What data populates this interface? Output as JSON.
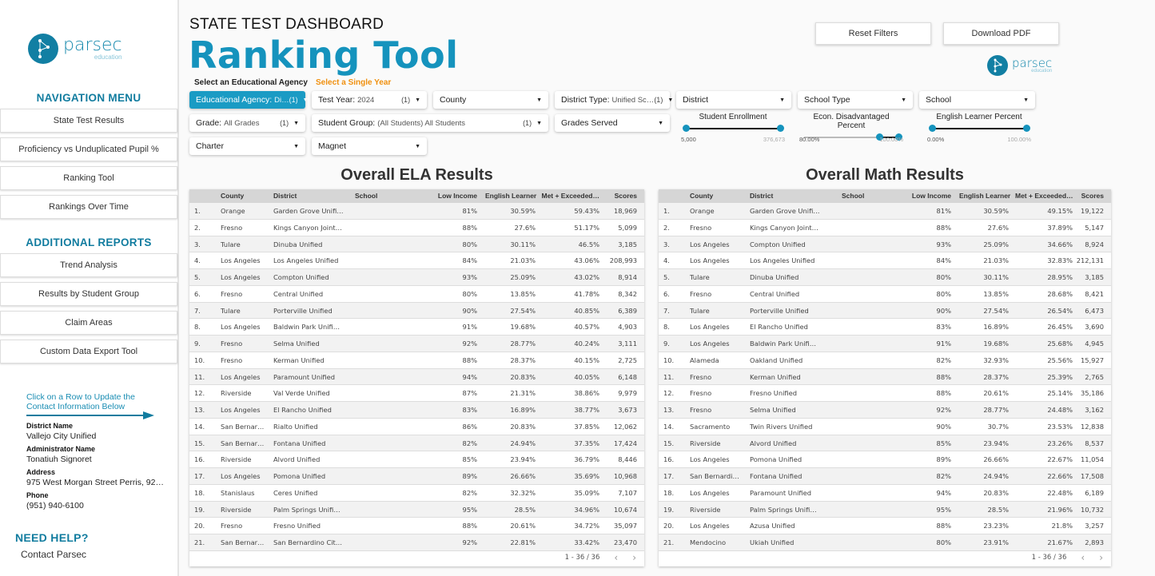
{
  "brand": {
    "name": "parsec",
    "sub": "education",
    "color": "#1593bd"
  },
  "sidebar": {
    "nav_title": "NAVIGATION MENU",
    "nav_items": [
      "State Test Results",
      "Proficiency vs Unduplicated Pupil %",
      "Ranking Tool",
      "Rankings Over Time"
    ],
    "reports_title": "ADDITIONAL REPORTS",
    "report_items": [
      "Trend Analysis",
      "Results by Student Group",
      "Claim Areas",
      "Custom Data Export Tool"
    ],
    "hint": "Click on a Row to Update the Contact Information Below",
    "contact": [
      {
        "label": "District Name",
        "value": "Vallejo City Unified"
      },
      {
        "label": "Administrator Name",
        "value": "Tonatiuh Signoret"
      },
      {
        "label": "Address",
        "value": "975 West Morgan Street Perris, 92…"
      },
      {
        "label": "Phone",
        "value": "(951) 940-6100"
      }
    ],
    "help_title": "NEED HELP?",
    "help_link": "Contact Parsec"
  },
  "header": {
    "subtitle": "STATE TEST DASHBOARD",
    "title": "Ranking Tool",
    "reset": "Reset Filters",
    "download": "Download PDF"
  },
  "filters": {
    "agency_label": "Select an Educational Agency",
    "year_label": "Select a Single Year",
    "year_label_color": "#f0900f",
    "dropdowns": [
      {
        "label": "Educational Agency:",
        "value": "Di…",
        "count": "(1)"
      },
      {
        "label": "Test Year:",
        "value": "2024",
        "count": "(1)"
      },
      {
        "label": "County",
        "value": "",
        "count": ""
      },
      {
        "label": "District Type:",
        "value": "Unified Sc…",
        "count": "(1)"
      },
      {
        "label": "District",
        "value": "",
        "count": ""
      },
      {
        "label": "School Type",
        "value": "",
        "count": ""
      },
      {
        "label": "School",
        "value": "",
        "count": ""
      },
      {
        "label": "Grade:",
        "value": "All Grades",
        "count": "(1)"
      },
      {
        "label": "Student Group:",
        "value": "(All Students) All Students",
        "count": "(1)"
      },
      {
        "label": "Grades Served",
        "value": "",
        "count": ""
      },
      {
        "label": "Charter",
        "value": "",
        "count": ""
      },
      {
        "label": "Magnet",
        "value": "",
        "count": ""
      }
    ],
    "sliders": [
      {
        "title": "Student Enrollment",
        "min_label": "5,000",
        "max_label": "376,673",
        "low": 0,
        "high": 1
      },
      {
        "title": "Econ. Disadvantaged Percent",
        "min_label": "80.00%",
        "max_label": "100.00%",
        "low": 0.8,
        "high": 1
      },
      {
        "title": "English Learner Percent",
        "min_label": "0.00%",
        "max_label": "100.00%",
        "low": 0,
        "high": 1
      }
    ]
  },
  "columns": [
    "County",
    "District",
    "School",
    "Low Income",
    "English Learner",
    "Met + Exceeded…",
    "Scores"
  ],
  "ela": {
    "title": "Overall ELA Results",
    "pagination": "1 - 36 / 36",
    "rows": [
      [
        "1.",
        "Orange",
        "Garden Grove Unifi…",
        "",
        "81%",
        "30.59%",
        "59.43%",
        "18,969"
      ],
      [
        "2.",
        "Fresno",
        "Kings Canyon Joint…",
        "",
        "88%",
        "27.6%",
        "51.17%",
        "5,099"
      ],
      [
        "3.",
        "Tulare",
        "Dinuba Unified",
        "",
        "80%",
        "30.11%",
        "46.5%",
        "3,185"
      ],
      [
        "4.",
        "Los Angeles",
        "Los Angeles Unified",
        "",
        "84%",
        "21.03%",
        "43.06%",
        "208,993"
      ],
      [
        "5.",
        "Los Angeles",
        "Compton Unified",
        "",
        "93%",
        "25.09%",
        "43.02%",
        "8,914"
      ],
      [
        "6.",
        "Fresno",
        "Central Unified",
        "",
        "80%",
        "13.85%",
        "41.78%",
        "8,342"
      ],
      [
        "7.",
        "Tulare",
        "Porterville Unified",
        "",
        "90%",
        "27.54%",
        "40.85%",
        "6,389"
      ],
      [
        "8.",
        "Los Angeles",
        "Baldwin Park Unifi…",
        "",
        "91%",
        "19.68%",
        "40.57%",
        "4,903"
      ],
      [
        "9.",
        "Fresno",
        "Selma Unified",
        "",
        "92%",
        "28.77%",
        "40.24%",
        "3,111"
      ],
      [
        "10.",
        "Fresno",
        "Kerman Unified",
        "",
        "88%",
        "28.37%",
        "40.15%",
        "2,725"
      ],
      [
        "11.",
        "Los Angeles",
        "Paramount Unified",
        "",
        "94%",
        "20.83%",
        "40.05%",
        "6,148"
      ],
      [
        "12.",
        "Riverside",
        "Val Verde Unified",
        "",
        "87%",
        "21.31%",
        "38.86%",
        "9,979"
      ],
      [
        "13.",
        "Los Angeles",
        "El Rancho Unified",
        "",
        "83%",
        "16.89%",
        "38.77%",
        "3,673"
      ],
      [
        "14.",
        "San Bernar…",
        "Rialto Unified",
        "",
        "86%",
        "20.83%",
        "37.85%",
        "12,062"
      ],
      [
        "15.",
        "San Bernar…",
        "Fontana Unified",
        "",
        "82%",
        "24.94%",
        "37.35%",
        "17,424"
      ],
      [
        "16.",
        "Riverside",
        "Alvord Unified",
        "",
        "85%",
        "23.94%",
        "36.79%",
        "8,446"
      ],
      [
        "17.",
        "Los Angeles",
        "Pomona Unified",
        "",
        "89%",
        "26.66%",
        "35.69%",
        "10,968"
      ],
      [
        "18.",
        "Stanislaus",
        "Ceres Unified",
        "",
        "82%",
        "32.32%",
        "35.09%",
        "7,107"
      ],
      [
        "19.",
        "Riverside",
        "Palm Springs Unifi…",
        "",
        "95%",
        "28.5%",
        "34.96%",
        "10,674"
      ],
      [
        "20.",
        "Fresno",
        "Fresno Unified",
        "",
        "88%",
        "20.61%",
        "34.72%",
        "35,097"
      ],
      [
        "21.",
        "San Bernar…",
        "San Bernardino Cit…",
        "",
        "92%",
        "22.81%",
        "33.42%",
        "23,470"
      ]
    ]
  },
  "math": {
    "title": "Overall Math Results",
    "pagination": "1 - 36 / 36",
    "rows": [
      [
        "1.",
        "Orange",
        "Garden Grove Unifi…",
        "",
        "81%",
        "30.59%",
        "49.15%",
        "19,122"
      ],
      [
        "2.",
        "Fresno",
        "Kings Canyon Joint…",
        "",
        "88%",
        "27.6%",
        "37.89%",
        "5,147"
      ],
      [
        "3.",
        "Los Angeles",
        "Compton Unified",
        "",
        "93%",
        "25.09%",
        "34.66%",
        "8,924"
      ],
      [
        "4.",
        "Los Angeles",
        "Los Angeles Unified",
        "",
        "84%",
        "21.03%",
        "32.83%",
        "212,131"
      ],
      [
        "5.",
        "Tulare",
        "Dinuba Unified",
        "",
        "80%",
        "30.11%",
        "28.95%",
        "3,185"
      ],
      [
        "6.",
        "Fresno",
        "Central Unified",
        "",
        "80%",
        "13.85%",
        "28.68%",
        "8,421"
      ],
      [
        "7.",
        "Tulare",
        "Porterville Unified",
        "",
        "90%",
        "27.54%",
        "26.54%",
        "6,473"
      ],
      [
        "8.",
        "Los Angeles",
        "El Rancho Unified",
        "",
        "83%",
        "16.89%",
        "26.45%",
        "3,690"
      ],
      [
        "9.",
        "Los Angeles",
        "Baldwin Park Unifi…",
        "",
        "91%",
        "19.68%",
        "25.68%",
        "4,945"
      ],
      [
        "10.",
        "Alameda",
        "Oakland Unified",
        "",
        "82%",
        "32.93%",
        "25.56%",
        "15,927"
      ],
      [
        "11.",
        "Fresno",
        "Kerman Unified",
        "",
        "88%",
        "28.37%",
        "25.39%",
        "2,765"
      ],
      [
        "12.",
        "Fresno",
        "Fresno Unified",
        "",
        "88%",
        "20.61%",
        "25.14%",
        "35,186"
      ],
      [
        "13.",
        "Fresno",
        "Selma Unified",
        "",
        "92%",
        "28.77%",
        "24.48%",
        "3,162"
      ],
      [
        "14.",
        "Sacramento",
        "Twin Rivers Unified",
        "",
        "90%",
        "30.7%",
        "23.53%",
        "12,838"
      ],
      [
        "15.",
        "Riverside",
        "Alvord Unified",
        "",
        "85%",
        "23.94%",
        "23.26%",
        "8,537"
      ],
      [
        "16.",
        "Los Angeles",
        "Pomona Unified",
        "",
        "89%",
        "26.66%",
        "22.67%",
        "11,054"
      ],
      [
        "17.",
        "San Bernardi…",
        "Fontana Unified",
        "",
        "82%",
        "24.94%",
        "22.66%",
        "17,508"
      ],
      [
        "18.",
        "Los Angeles",
        "Paramount Unified",
        "",
        "94%",
        "20.83%",
        "22.48%",
        "6,189"
      ],
      [
        "19.",
        "Riverside",
        "Palm Springs Unifi…",
        "",
        "95%",
        "28.5%",
        "21.96%",
        "10,732"
      ],
      [
        "20.",
        "Los Angeles",
        "Azusa Unified",
        "",
        "88%",
        "23.23%",
        "21.8%",
        "3,257"
      ],
      [
        "21.",
        "Mendocino",
        "Ukiah Unified",
        "",
        "80%",
        "23.91%",
        "21.67%",
        "2,893"
      ]
    ]
  }
}
